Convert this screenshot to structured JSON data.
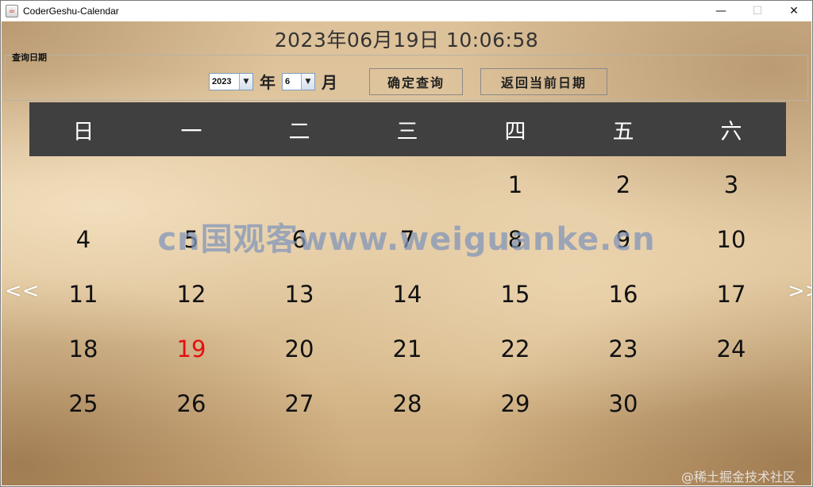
{
  "window": {
    "title": "CoderGeshu-Calendar",
    "app_icon": "java-icon",
    "minimize": "—",
    "maximize": "☐",
    "close": "✕"
  },
  "clock": {
    "datetime": "2023年06月19日  10:06:58"
  },
  "query": {
    "panel_title": "查询日期",
    "year_value": "2023",
    "year_unit": "年",
    "month_value": "6",
    "month_unit": "月",
    "confirm_label": "确定查询",
    "return_label": "返回当前日期"
  },
  "weekdays": [
    "日",
    "一",
    "二",
    "三",
    "四",
    "五",
    "六"
  ],
  "calendar": {
    "first_weekday_index": 4,
    "days_in_month": 30,
    "today": 19,
    "day_labels": [
      "1",
      "2",
      "3",
      "4",
      "5",
      "6",
      "7",
      "8",
      "9",
      "10",
      "11",
      "12",
      "13",
      "14",
      "15",
      "16",
      "17",
      "18",
      "19",
      "20",
      "21",
      "22",
      "23",
      "24",
      "25",
      "26",
      "27",
      "28",
      "29",
      "30"
    ]
  },
  "nav": {
    "prev": "<<",
    "next": ">>"
  },
  "overlay": {
    "watermark": "cn国观客www.weiguanke.cn",
    "credit": "@稀土掘金技术社区"
  },
  "colors": {
    "header_bar": "#404040",
    "today": "#e51010",
    "parchment": "#dcc199"
  }
}
